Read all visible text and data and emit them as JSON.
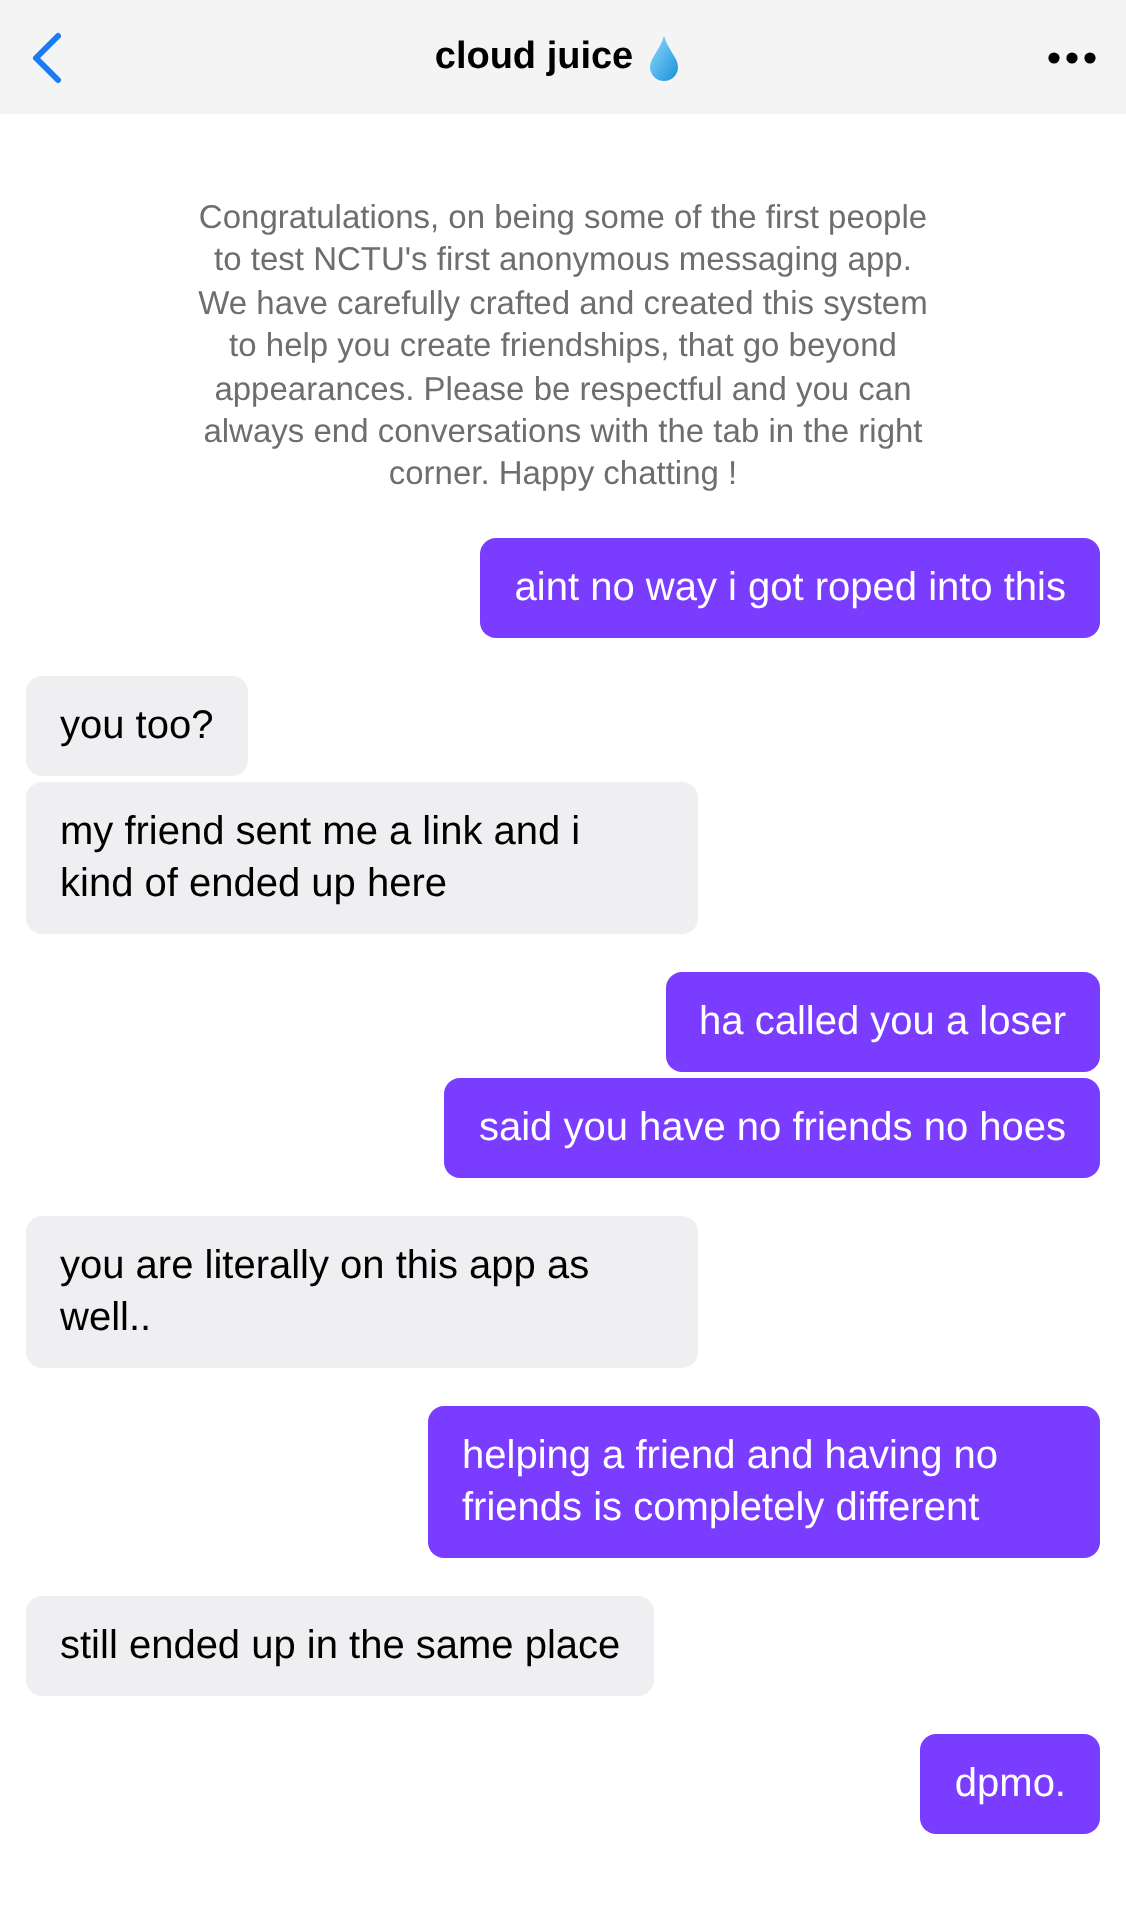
{
  "header": {
    "title": "cloud juice"
  },
  "notice": "Congratulations, on being some of the first people to test NCTU's first anonymous messaging app. We have carefully crafted and created this system to help you create friendships, that go beyond appearances. Please be respectful and you can always end conversations with the tab in the right corner. Happy chatting !",
  "messages": [
    {
      "kind": "sent",
      "text": "aint no way i got roped into this"
    },
    {
      "kind": "received",
      "text": "you too?"
    },
    {
      "kind": "received",
      "text": "my friend sent me a link and i kind of ended up here"
    },
    {
      "kind": "sent",
      "text": "ha called you a loser"
    },
    {
      "kind": "sent",
      "text": "said you have no friends no hoes"
    },
    {
      "kind": "received",
      "text": "you are literally on this app as well.."
    },
    {
      "kind": "sent",
      "text": "helping a friend and having no friends is completely different"
    },
    {
      "kind": "received",
      "text": "still ended up in the same place"
    },
    {
      "kind": "sent",
      "text": "dpmo."
    }
  ]
}
